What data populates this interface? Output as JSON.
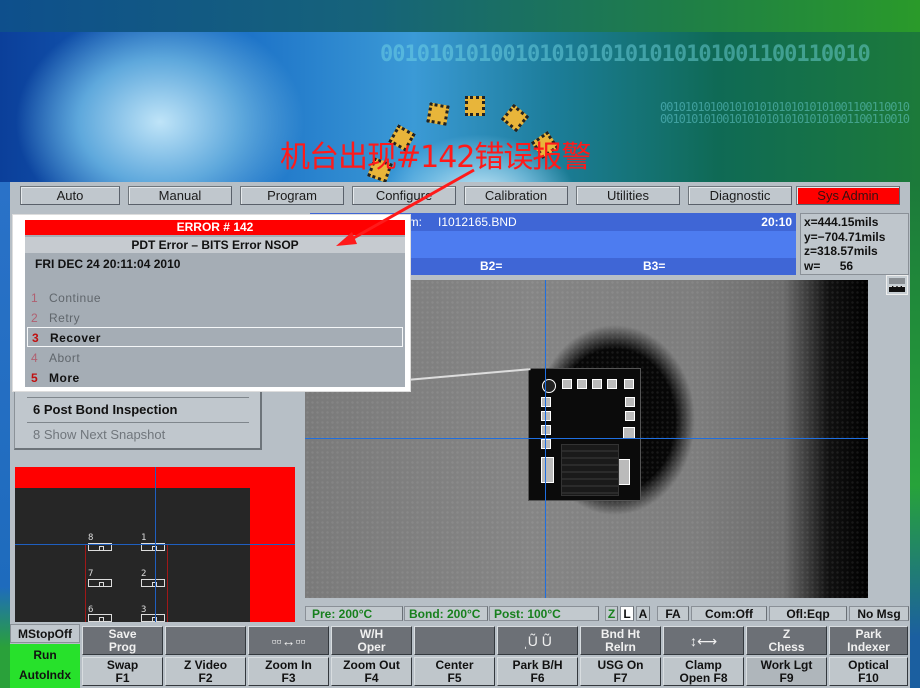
{
  "annotation": "机台出现#142错误报警",
  "background": {
    "binary_text": "0010101010010101010101010101001100110010"
  },
  "menu": {
    "items": [
      {
        "label": "Auto",
        "active": false
      },
      {
        "label": "Manual",
        "active": false
      },
      {
        "label": "Program",
        "active": false
      },
      {
        "label": "Configure",
        "active": false
      },
      {
        "label": "Calibration",
        "active": false
      },
      {
        "label": "Utilities",
        "active": false
      },
      {
        "label": "Diagnostic",
        "active": false
      },
      {
        "label": "Sys Admin",
        "active": true
      }
    ]
  },
  "status": {
    "program_label": "am:",
    "program_file": "I1012165.BND",
    "time": "20:10",
    "b2_label": "B2=",
    "b3_label": "B3="
  },
  "coords": {
    "x": "x=444.15mils",
    "y": "y=−704.71mils",
    "z": "z=318.57mils",
    "w_label": "w=",
    "w_value": "56"
  },
  "error_dialog": {
    "title": "ERROR # 142",
    "subtitle": "PDT Error – BITS Error NSOP",
    "timestamp": "FRI DEC 24 20:11:04 2010",
    "options": [
      {
        "num": "1",
        "label": "Continue",
        "state": "disabled"
      },
      {
        "num": "2",
        "label": "Retry",
        "state": "disabled"
      },
      {
        "num": "3",
        "label": "Recover",
        "state": "selected"
      },
      {
        "num": "4",
        "label": "Abort",
        "state": "disabled"
      },
      {
        "num": "5",
        "label": "More",
        "state": "enabled"
      }
    ]
  },
  "left_menu": {
    "items": [
      {
        "label": "6 Post Bond Inspection",
        "enabled": true
      },
      {
        "label": "8 Show Next Snapshot",
        "enabled": false
      }
    ]
  },
  "wire_map": {
    "pads": [
      {
        "num": "8"
      },
      {
        "num": "1"
      },
      {
        "num": "7"
      },
      {
        "num": "2"
      },
      {
        "num": "6"
      },
      {
        "num": "3"
      }
    ]
  },
  "temps": {
    "pre": "Pre:  200°C",
    "bond": "Bond:  200°C",
    "post": "Post:  100°C",
    "z": "Z",
    "l": "L",
    "a": "A",
    "fa": "FA",
    "com": "Com:Off",
    "ofl": "Ofl:Eqp",
    "msg": "No Msg"
  },
  "machine_state": {
    "mstop": "MStopOff",
    "run": "Run",
    "autoindex": "AutoIndx"
  },
  "fkeys_top": [
    {
      "line1": "Save",
      "line2": "Prog"
    },
    {
      "line1": "",
      "line2": ""
    },
    {
      "icon": "swap-pads-icon",
      "glyph": "▫▫↔▫▫"
    },
    {
      "line1": "W/H",
      "line2": "Oper"
    },
    {
      "line1": "",
      "line2": ""
    },
    {
      "icon": "capillary-icon",
      "glyph": "ˌŨ  Ũ"
    },
    {
      "line1": "Bnd Ht",
      "line2": "Relrn"
    },
    {
      "icon": "axis-toggle-icon",
      "glyph": "↕⟷"
    },
    {
      "line1": "Z",
      "line2": "Chess"
    },
    {
      "line1": "Park",
      "line2": "Indexer"
    }
  ],
  "fkeys_bottom": [
    {
      "line1": "Swap",
      "line2": "F1"
    },
    {
      "line1": "Z Video",
      "line2": "F2"
    },
    {
      "line1": "Zoom  In",
      "line2": "F3"
    },
    {
      "line1": "Zoom Out",
      "line2": "F4"
    },
    {
      "line1": "Center",
      "line2": "F5"
    },
    {
      "line1": "Park B/H",
      "line2": "F6"
    },
    {
      "line1": "USG On",
      "line2": "F7"
    },
    {
      "line1": "Clamp",
      "line2": "Open F8"
    },
    {
      "line1": "Work Lgt",
      "line2": "F9"
    },
    {
      "line1": "Optical",
      "line2": "F10"
    }
  ]
}
